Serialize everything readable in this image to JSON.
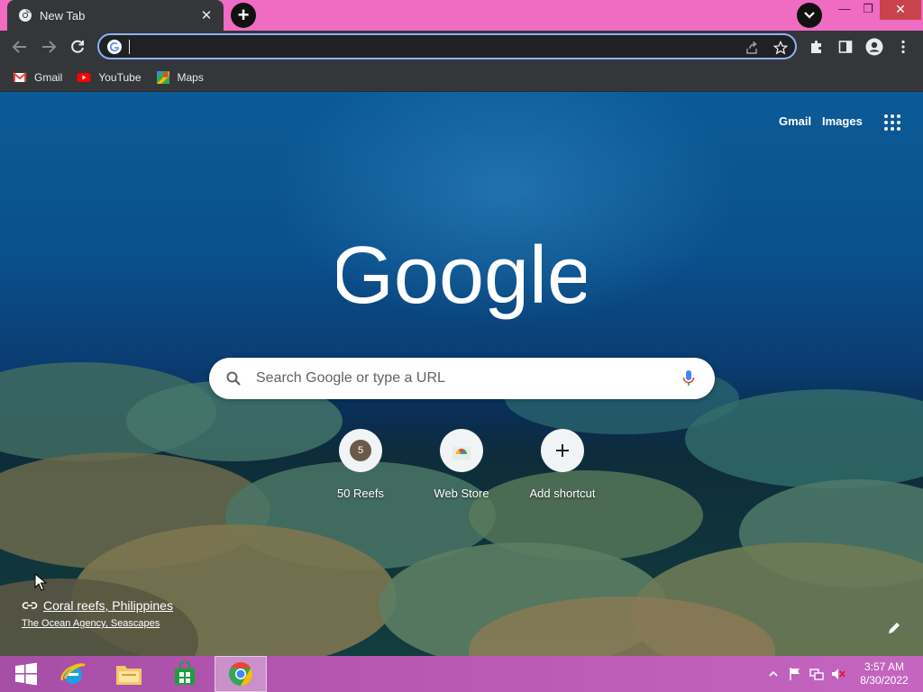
{
  "tab": {
    "title": "New Tab"
  },
  "omnibox": {
    "value": ""
  },
  "bookmarks": [
    {
      "label": "Gmail",
      "icon": "gmail-icon"
    },
    {
      "label": "YouTube",
      "icon": "youtube-icon"
    },
    {
      "label": "Maps",
      "icon": "maps-icon"
    }
  ],
  "ntp": {
    "top_links": {
      "gmail": "Gmail",
      "images": "Images"
    },
    "logo_text": "Google",
    "search_placeholder": "Search Google or type a URL",
    "shortcuts": [
      {
        "label": "50 Reefs",
        "badge": "5"
      },
      {
        "label": "Web Store"
      },
      {
        "label": "Add shortcut"
      }
    ],
    "attribution": {
      "title": "Coral reefs, Philippines",
      "subtitle": "The Ocean Agency, Seascapes"
    }
  },
  "taskbar": {
    "clock_time": "3:57 AM",
    "clock_date": "8/30/2022"
  },
  "colors": {
    "titlebar": "#f06bc2",
    "toolbar": "#35363a",
    "omnibox_focus": "#8ab4f8",
    "taskbar": "#b657b3"
  }
}
